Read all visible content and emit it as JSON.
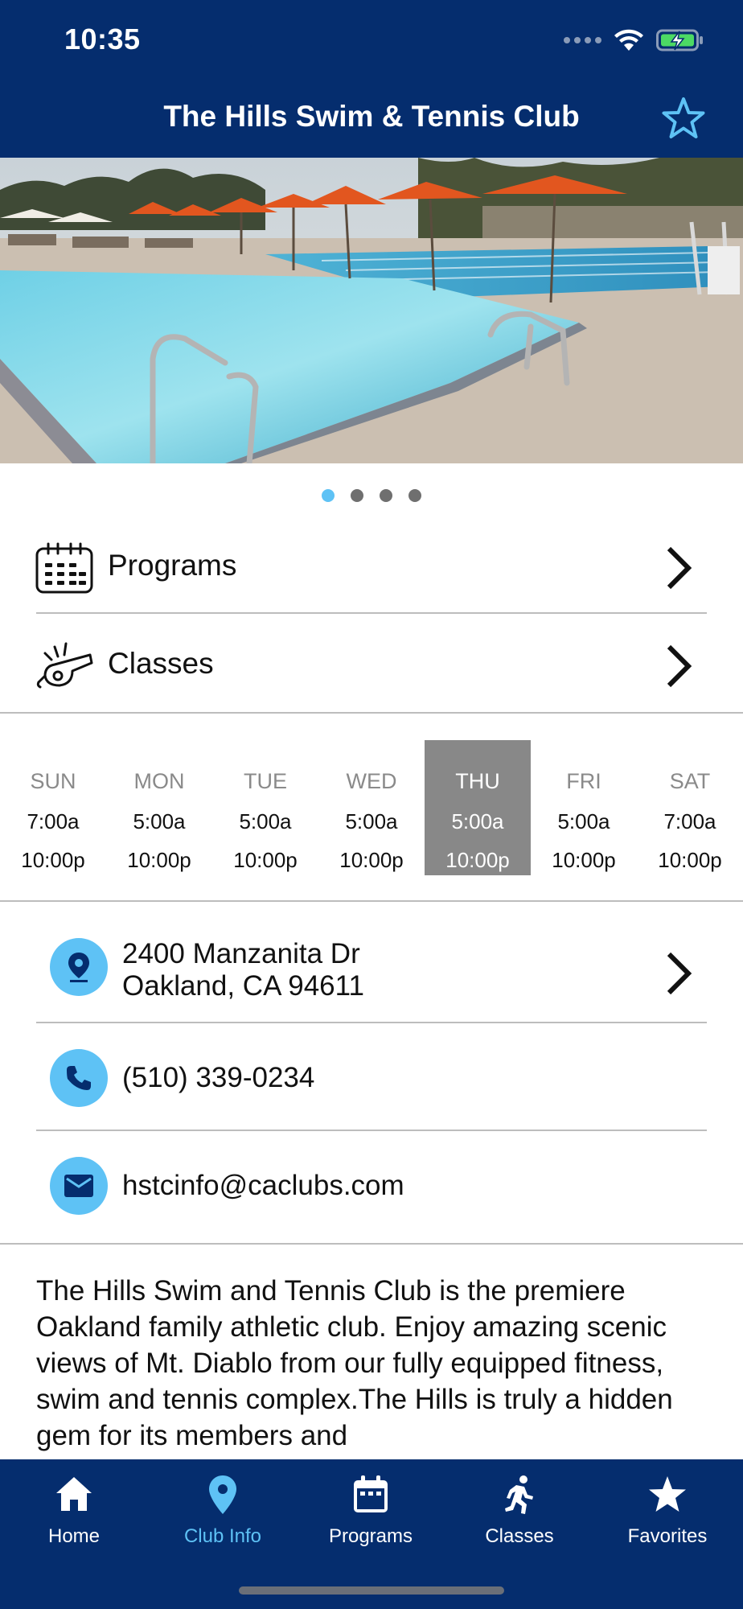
{
  "status_bar": {
    "time": "10:35"
  },
  "nav": {
    "title": "The Hills Swim & Tennis Club"
  },
  "carousel": {
    "slides": 4,
    "active_index": 0
  },
  "menu": [
    {
      "label": "Programs",
      "icon": "calendar-icon"
    },
    {
      "label": "Classes",
      "icon": "whistle-icon"
    }
  ],
  "hours": {
    "today_index": 4,
    "days": [
      {
        "name": "SUN",
        "open": "7:00a",
        "close": "10:00p"
      },
      {
        "name": "MON",
        "open": "5:00a",
        "close": "10:00p"
      },
      {
        "name": "TUE",
        "open": "5:00a",
        "close": "10:00p"
      },
      {
        "name": "WED",
        "open": "5:00a",
        "close": "10:00p"
      },
      {
        "name": "THU",
        "open": "5:00a",
        "close": "10:00p"
      },
      {
        "name": "FRI",
        "open": "5:00a",
        "close": "10:00p"
      },
      {
        "name": "SAT",
        "open": "7:00a",
        "close": "10:00p"
      }
    ]
  },
  "contact": {
    "address_line1": "2400 Manzanita Dr",
    "address_line2": "Oakland, CA 94611",
    "phone": "(510) 339-0234",
    "email": "hstcinfo@caclubs.com"
  },
  "description": "The Hills Swim and Tennis Club is the premiere Oakland family athletic club. Enjoy amazing scenic views of Mt. Diablo from our fully equipped fitness, swim and tennis complex.The Hills is truly a hidden gem for its members and",
  "tabs": [
    {
      "label": "Home",
      "icon": "home-icon"
    },
    {
      "label": "Club Info",
      "icon": "map-pin-icon"
    },
    {
      "label": "Programs",
      "icon": "calendar-icon"
    },
    {
      "label": "Classes",
      "icon": "runner-icon"
    },
    {
      "label": "Favorites",
      "icon": "star-icon"
    }
  ],
  "colors": {
    "header_bg": "#052d6e",
    "accent": "#5ec2f5",
    "today_bg": "#888888"
  }
}
